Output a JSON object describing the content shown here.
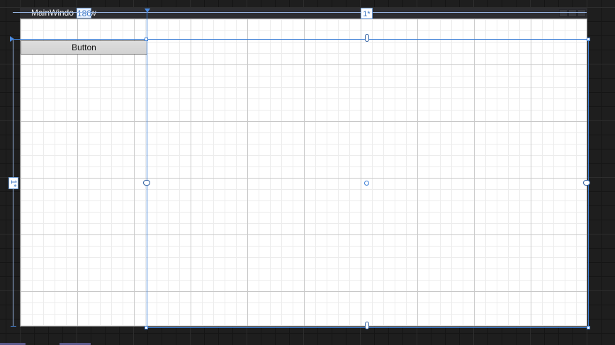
{
  "window": {
    "title_prefix": "MainWindo",
    "title_suffix": "w",
    "column_width_value": "180"
  },
  "grid": {
    "column_star_label": "1*",
    "row_star_label": "1*"
  },
  "controls": {
    "button_label": "Button"
  },
  "colors": {
    "canvas_bg": "#1e1e1e",
    "surface_bg": "#ffffff",
    "selection": "#3d7fd6",
    "button_bg": "#dddddd"
  },
  "icons": [
    "anchor-icon",
    "resize-handle-icon",
    "window-minimize-icon",
    "window-maximize-icon",
    "window-close-icon"
  ]
}
